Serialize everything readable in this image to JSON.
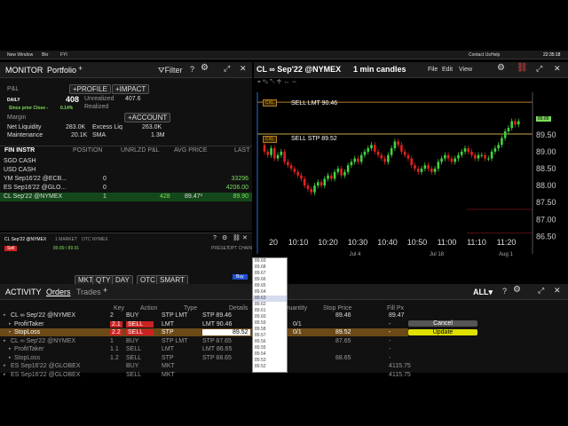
{
  "topbar": {
    "items": [
      "New Window",
      "Bkr",
      "FYI"
    ],
    "right": [
      "Contact Us",
      "Help"
    ],
    "time": "22:35:18"
  },
  "monitor": {
    "title": "MONITOR",
    "tab": "Portfolio",
    "filter": "Filter",
    "pnl_label": "P&L",
    "daily_label": "DAILY",
    "daily_value": "408",
    "profile_btn": "PROFILE",
    "impact_btn": "IMPACT",
    "unrealized_label": "Unrealized",
    "unrealized_value": "407.6",
    "since_close": "Since prior Close -",
    "since_close_pct": "0.14%",
    "realized_label": "Realized",
    "margin_label": "Margin",
    "account_btn": "ACCOUNT",
    "net_liq_label": "Net Liquidity",
    "net_liq_value": "283.0K",
    "excess_liq_label": "Excess Liq",
    "excess_liq_value": "263.0K",
    "maintenance_label": "Maintenance",
    "maintenance_value": "20.1K",
    "sma_label": "SMA",
    "sma_value": "1.3M",
    "columns": [
      "FIN INSTR",
      "POSITION",
      "UNRLZD P&L",
      "AVG PRICE",
      "LAST"
    ],
    "rows": [
      {
        "instr": "SGD CASH",
        "position": "",
        "pnl": "",
        "avg": "",
        "last": ""
      },
      {
        "instr": "USD CASH",
        "position": "",
        "pnl": "",
        "avg": "",
        "last": ""
      },
      {
        "instr": "YM Sep16'22 @ECB...",
        "position": "0",
        "pnl": "",
        "avg": "",
        "last": "33296"
      },
      {
        "instr": "ES Sep16'22 @GLO...",
        "position": "0",
        "pnl": "",
        "avg": "",
        "last": "4206.00"
      },
      {
        "instr": "CL Sep'22 @NYMEX",
        "position": "1",
        "pnl": "428",
        "avg": "89.47³",
        "last": "89.90"
      }
    ]
  },
  "orderentry": {
    "title": "CL Sep'22 @NYMEX",
    "market": "1 MARKET",
    "otc": "OTC NYMEX",
    "sell": "Sell",
    "buy": "Buy",
    "bid_ask": "89.89 / 89.91",
    "fields": [
      "MKT",
      "QTY 1",
      "DAY",
      "OTC",
      "SMART"
    ],
    "preset": "PRESET",
    "opt_chain": "OPT CHAIN"
  },
  "chart": {
    "title": "CL ∞ Sep'22 @NYMEX",
    "interval": "1 min candles",
    "menu": [
      "File",
      "Edit",
      "View"
    ],
    "sell_lmt_label": "SELL LMT 90.46",
    "sell_stp_label": "SELL STP 89.52",
    "cxl": "CXL",
    "last_price_tag": "89.89",
    "y_ticks": [
      "89.50",
      "89.00",
      "88.50",
      "88.00",
      "87.50",
      "87.00",
      "86.50"
    ],
    "x_ticks": [
      "20",
      "10:10",
      "10:20",
      "10:30",
      "10:40",
      "10:50",
      "11:00",
      "11:10",
      "11:20"
    ],
    "date_labels": [
      "Jul 4",
      "Jul 18",
      "Aug 1"
    ]
  },
  "chart_data": {
    "type": "candlestick",
    "ylim": [
      86.25,
      90.75
    ],
    "title": "CL ∞ Sep'22 @NYMEX",
    "open": [
      89.2,
      89.0,
      88.9,
      89.1,
      88.8,
      88.9,
      89.0,
      88.7,
      88.6,
      88.5,
      88.4,
      88.3,
      88.2,
      88.0,
      87.9,
      87.8,
      88.0,
      88.1,
      88.0,
      88.2,
      88.3,
      88.2,
      88.4,
      88.5,
      88.3,
      88.4,
      88.6,
      88.7,
      88.8,
      88.7,
      88.9,
      89.0,
      89.1,
      89.2,
      89.0,
      88.9,
      88.8,
      88.7,
      88.9,
      89.1,
      89.3,
      89.2,
      89.0,
      88.9,
      88.8,
      88.6,
      88.5,
      88.4,
      88.5,
      88.6,
      88.5,
      88.4,
      88.5,
      88.7,
      88.8,
      88.9,
      88.8,
      88.7,
      88.8,
      88.9,
      89.0,
      89.1,
      89.0,
      88.9,
      88.8,
      88.9,
      88.9,
      88.8,
      88.8,
      89.0,
      89.1,
      89.2,
      89.4,
      89.6,
      89.7,
      89.9,
      89.8
    ],
    "close": [
      89.0,
      88.9,
      89.1,
      88.8,
      88.9,
      89.0,
      88.7,
      88.6,
      88.5,
      88.4,
      88.3,
      88.2,
      88.0,
      87.9,
      87.8,
      88.0,
      88.1,
      88.0,
      88.2,
      88.3,
      88.2,
      88.4,
      88.5,
      88.3,
      88.4,
      88.6,
      88.7,
      88.8,
      88.7,
      88.9,
      89.0,
      89.1,
      89.2,
      89.0,
      88.9,
      88.8,
      88.7,
      88.9,
      89.1,
      89.3,
      89.2,
      89.0,
      88.9,
      88.8,
      88.6,
      88.5,
      88.4,
      88.5,
      88.6,
      88.5,
      88.4,
      88.5,
      88.7,
      88.8,
      88.9,
      88.8,
      88.7,
      88.8,
      88.9,
      89.0,
      89.1,
      89.0,
      88.9,
      88.8,
      88.9,
      88.9,
      88.8,
      88.8,
      89.0,
      89.1,
      89.2,
      89.4,
      89.6,
      89.7,
      89.9,
      89.8,
      89.9
    ],
    "hlines": [
      {
        "label": "SELL LMT",
        "value": 90.46
      },
      {
        "label": "SELL STP",
        "value": 89.52
      }
    ]
  },
  "activity": {
    "title": "ACTIVITY",
    "tab_orders": "Orders",
    "tab_trades": "Trades",
    "all": "ALL",
    "columns": [
      "Key",
      "Action",
      "Type",
      "Details",
      "Quantity",
      "Stop Price",
      "Fill Px"
    ],
    "rows": [
      {
        "instr": "CL ∞ Sep'22 @NYMEX",
        "key": "2",
        "action": "BUY",
        "type": "STP LMT",
        "details": "STP 89.46",
        "qty": "",
        "stop": "89.46",
        "fill": "89.47"
      },
      {
        "instr": "ProfitTaker",
        "key": "2.1",
        "action": "SELL",
        "type": "LMT",
        "details": "LMT 90.46",
        "qty": "0/1",
        "stop": "",
        "fill": "-"
      },
      {
        "instr": "StopLoss",
        "key": "2.2",
        "action": "SELL",
        "type": "STP",
        "details": "89.52",
        "qty": "0/1",
        "stop": "89.52",
        "fill": "-"
      },
      {
        "instr": "CL ∞ Sep'22 @NYMEX",
        "key": "1",
        "action": "BUY",
        "type": "STP LMT",
        "details": "STP 87.65",
        "qty": "",
        "stop": "87.65",
        "fill": "-"
      },
      {
        "instr": "ProfitTaker",
        "key": "1.1",
        "action": "SELL",
        "type": "LMT",
        "details": "LMT 86.65",
        "qty": "",
        "stop": "",
        "fill": "-"
      },
      {
        "instr": "StopLoss",
        "key": "1.2",
        "action": "SELL",
        "type": "STP",
        "details": "STP 88.65",
        "qty": "",
        "stop": "88.65",
        "fill": "-"
      },
      {
        "instr": "ES Sep16'22 @GLOBEX",
        "key": "",
        "action": "BUY",
        "type": "MKT",
        "details": "",
        "qty": "",
        "stop": "",
        "fill": "4115.75"
      },
      {
        "instr": "ES Sep16'22 @GLOBEX",
        "key": "",
        "action": "SELL",
        "type": "MKT",
        "details": "",
        "qty": "",
        "stop": "",
        "fill": "4115.75"
      }
    ],
    "cancel_btn": "Cancel",
    "update_btn": "Update"
  },
  "price_ladder": {
    "values": [
      "89.69",
      "89.68",
      "89.67",
      "89.66",
      "89.65",
      "89.64",
      "89.63",
      "89.62",
      "89.61",
      "89.60",
      "89.59",
      "89.58",
      "89.57",
      "89.56",
      "89.55",
      "89.54",
      "89.53",
      "89.52"
    ]
  },
  "colors": {
    "green": "#7ddc5a",
    "red": "#e84a4a",
    "orange_band": "#b57a2a",
    "yellow": "#e0e000"
  }
}
